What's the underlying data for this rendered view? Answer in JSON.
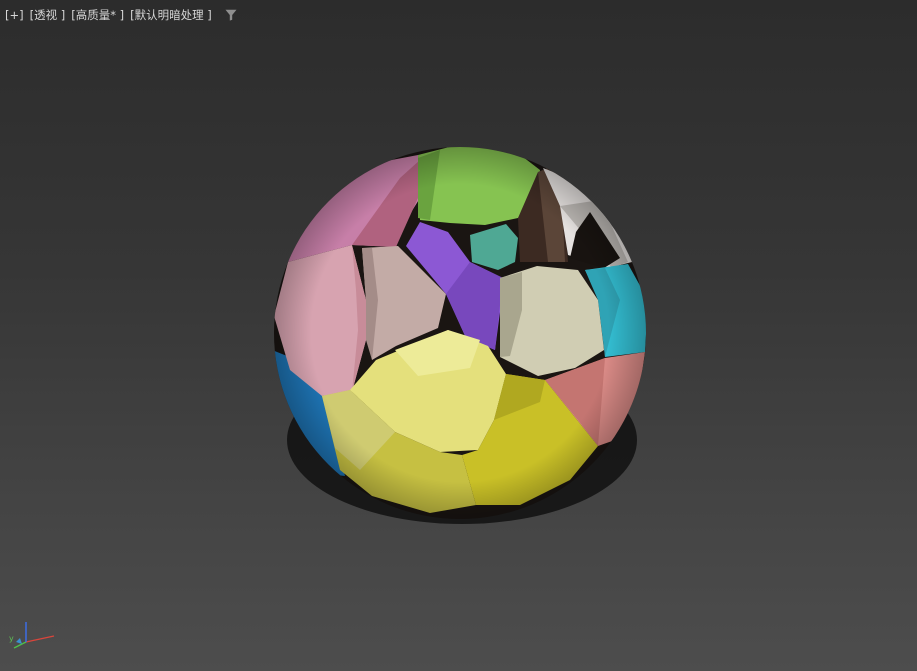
{
  "viewport": {
    "labels": {
      "plus": "[+]",
      "view": "[透视 ]",
      "quality": "[高质量* ]",
      "shading": "[默认明暗处理 ]"
    },
    "filter_icon": "filter-icon"
  },
  "scene": {
    "object": "faceted-sphere",
    "facet_colors": {
      "pink": "#c77fa8",
      "light_pink": "#d7a3b0",
      "green": "#86c351",
      "teal": "#4fa894",
      "purple": "#8c58d4",
      "taupe": "#c3aba6",
      "beige": "#d0cdb3",
      "cyan": "#33bcd0",
      "salmon": "#d98a86",
      "yellow": "#e4e07c",
      "olive": "#c6c042",
      "blue": "#1e74b4",
      "white": "#e6e2e0"
    }
  },
  "axis": {
    "x_color": "#d9453b",
    "y_color": "#4fc04a",
    "z_color": "#3b6ff0"
  }
}
